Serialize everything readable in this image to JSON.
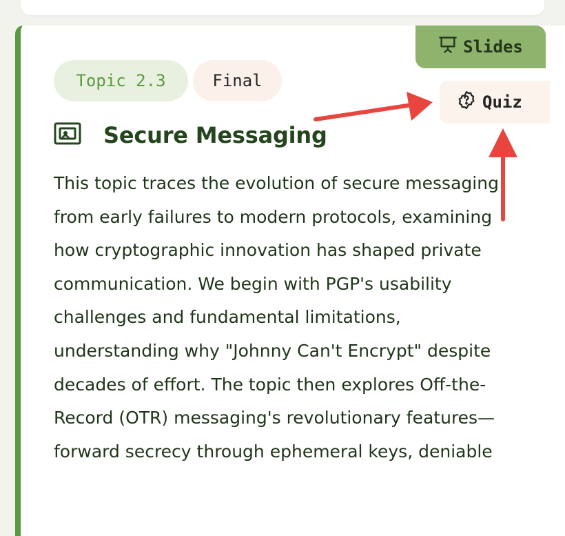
{
  "tags": {
    "topic": "Topic 2.3",
    "status": "Final"
  },
  "actions": {
    "slides_label": "Slides",
    "quiz_label": "Quiz"
  },
  "topic": {
    "title": "Secure Messaging",
    "icon": "presentation-screen-icon",
    "description": "This topic traces the evolution of secure messaging from early failures to modern protocols, examining how cryptographic innovation has shaped private communication. We begin with PGP's usability challenges and fundamental limitations, understanding why \"Johnny Can't Encrypt\" despite decades of effort. The topic then explores Off-the-Record (OTR) messaging's revolutionary features—forward secrecy through ephemeral keys, deniable"
  },
  "colors": {
    "accent": "#5a9a3f",
    "slides_bg": "#8db36c",
    "quiz_bg": "#fbf3ec",
    "annotation_arrow": "#e9453f"
  }
}
